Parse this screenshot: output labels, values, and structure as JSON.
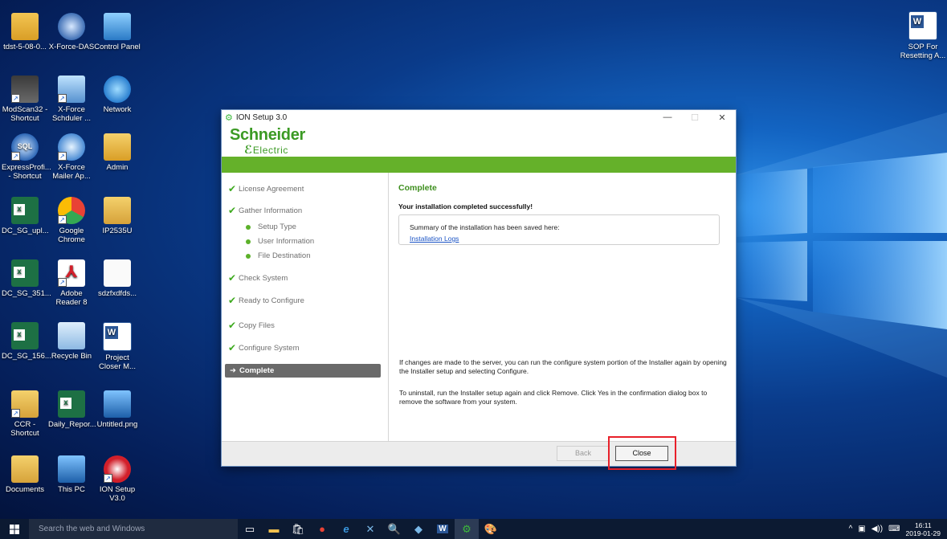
{
  "desktop": {
    "icons_left": [
      {
        "label": "tdst-5-08-0...",
        "icon": "folder-app-icon"
      },
      {
        "label": "X-Force-DAS",
        "icon": "xforce-das-icon"
      },
      {
        "label": "Control Panel",
        "icon": "control-panel-icon"
      },
      {
        "label": "ModScan32 - Shortcut",
        "icon": "modscan-icon"
      },
      {
        "label": "X-Force Schduler ...",
        "icon": "xforce-scheduler-icon"
      },
      {
        "label": "Network",
        "icon": "network-icon"
      },
      {
        "label": "ExpressProfi... - Shortcut",
        "icon": "sql-icon"
      },
      {
        "label": "X-Force Mailer Ap...",
        "icon": "xforce-mailer-icon"
      },
      {
        "label": "Admin",
        "icon": "user-folder-icon"
      },
      {
        "label": "DC_SG_upl...",
        "icon": "excel-icon"
      },
      {
        "label": "Google Chrome",
        "icon": "chrome-icon"
      },
      {
        "label": "IP2535U",
        "icon": "folder-icon"
      },
      {
        "label": "DC_SG_351...",
        "icon": "excel-icon"
      },
      {
        "label": "Adobe Reader 8",
        "icon": "adobe-reader-icon"
      },
      {
        "label": "sdzfxdfds...",
        "icon": "text-file-icon"
      },
      {
        "label": "DC_SG_156...",
        "icon": "excel-icon"
      },
      {
        "label": "Recycle Bin",
        "icon": "recycle-bin-icon"
      },
      {
        "label": "Project Closer M...",
        "icon": "word-icon"
      },
      {
        "label": "CCR - Shortcut",
        "icon": "folder-shortcut-icon"
      },
      {
        "label": "Daily_Repor...",
        "icon": "excel-icon"
      },
      {
        "label": "Untitled.png",
        "icon": "image-file-icon"
      },
      {
        "label": "Documents",
        "icon": "documents-folder-icon"
      },
      {
        "label": "This PC",
        "icon": "this-pc-icon"
      },
      {
        "label": "ION Setup V3.0",
        "icon": "ion-setup-icon"
      }
    ],
    "icon_right": {
      "label": "SOP For Resetting A...",
      "icon": "word-icon"
    }
  },
  "installer": {
    "title": "ION Setup 3.0",
    "brand_line1": "Schneider",
    "brand_line2": "Electric",
    "steps": {
      "license": "License Agreement",
      "gather": "Gather Information",
      "setup_type": "Setup Type",
      "user_info": "User Information",
      "file_dest": "File Destination",
      "check": "Check System",
      "ready": "Ready to Configure",
      "copy": "Copy Files",
      "configure": "Configure System",
      "complete": "Complete"
    },
    "content": {
      "heading": "Complete",
      "success": "Your installation completed successfully!",
      "summary_text": "Summary of the installation has been saved here:",
      "summary_link": "Installation Logs",
      "para1": "If changes are made to the server,  you can run the configure system portion of the Installer again by opening the Installer setup and selecting Configure.",
      "para2": "To uninstall, run the Installer setup again and click Remove. Click Yes in the confirmation dialog box to remove the software from your system."
    },
    "buttons": {
      "back": "Back",
      "close": "Close"
    }
  },
  "taskbar": {
    "search_placeholder": "Search the web and Windows",
    "clock_time": "16:11",
    "clock_date": "2019-01-29"
  },
  "colors": {
    "brand_green": "#3b9a24",
    "green_bar": "#65b12a",
    "highlight_red": "#e8202a"
  }
}
